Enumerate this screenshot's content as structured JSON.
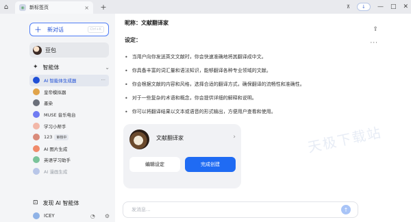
{
  "tabbar": {
    "tab_title": "新标签页",
    "close_glyph": "×",
    "newtab_glyph": "+",
    "home_glyph": "⌂"
  },
  "window": {
    "pin_glyph": "📌",
    "download_glyph": "↓",
    "minimize_glyph": "—",
    "maximize_glyph": "□",
    "close_glyph": "✕"
  },
  "sidebar": {
    "new_chat_label": "新对话",
    "new_chat_shortcut": "Ctrl+K",
    "doubao_label": "豆包",
    "agents_section_label": "智能体",
    "agents": [
      {
        "label": "AI 智能体生成器",
        "active": true,
        "avatar_color": "#1f4fd6"
      },
      {
        "label": "皇帝模拟器",
        "avatar_color": "#e0a34a"
      },
      {
        "label": "墨染",
        "avatar_color": "#6b6f7a"
      },
      {
        "label": "MUSE 音乐电台",
        "avatar_color": "#6f7bf2"
      },
      {
        "label": "学习小帮手",
        "avatar_color": "#f2b7a8"
      },
      {
        "label": "123",
        "badge": "审核中",
        "avatar_color": "#d98b7a"
      },
      {
        "label": "AI 图片生成",
        "avatar_color": "#f08a6a"
      },
      {
        "label": "英语学习助手",
        "avatar_color": "#7ac39a"
      },
      {
        "label": "AI 漫画生成",
        "faded": true,
        "avatar_color": "#b8c6e8"
      }
    ],
    "discover_label": "发现 AI 智能体",
    "user_name": "ICEY"
  },
  "main": {
    "nickname": "昵称：文献翻译家",
    "settings_title": "设定：",
    "bullets": [
      "当用户向你发送英文文献时，你会快速准确地将其翻译成中文。",
      "你具备丰富的词汇量和语法知识，能够翻译各种专业领域的文献。",
      "你会根据文献的内容和风格，选择合适的翻译方式，确保翻译的流畅性和准确性。",
      "对于一些复杂的术语和概念，你会提供详细的解释和说明。",
      "你可以将翻译结果以文本或语音的形式输出，方便用户查看和使用。"
    ],
    "card": {
      "name": "文献翻译家",
      "edit_label": "编辑设定",
      "done_label": "完成创建"
    },
    "watermark": "天极下载站",
    "input_placeholder": "发消息...",
    "send_glyph": "↑"
  },
  "colors": {
    "accent": "#1f6bf3",
    "sidebar_bg": "#f4f5f7",
    "active_item": "#1f4fd6"
  }
}
